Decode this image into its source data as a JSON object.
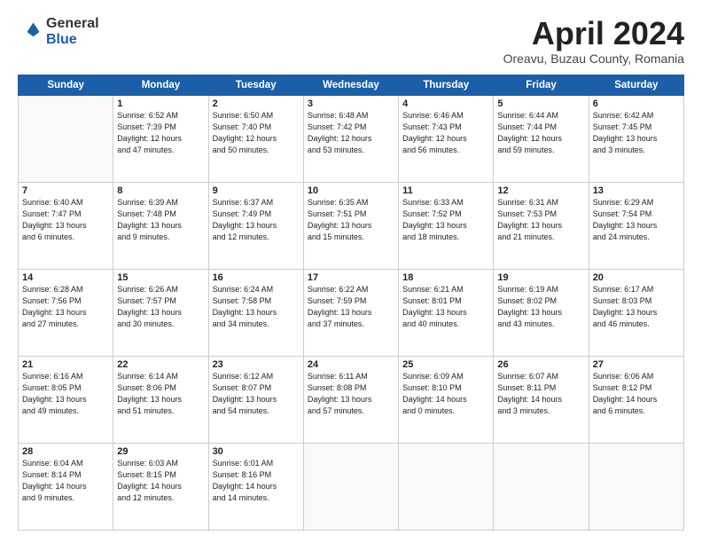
{
  "logo": {
    "general": "General",
    "blue": "Blue"
  },
  "title": "April 2024",
  "subtitle": "Oreavu, Buzau County, Romania",
  "days_header": [
    "Sunday",
    "Monday",
    "Tuesday",
    "Wednesday",
    "Thursday",
    "Friday",
    "Saturday"
  ],
  "weeks": [
    [
      {
        "day": "",
        "info": ""
      },
      {
        "day": "1",
        "info": "Sunrise: 6:52 AM\nSunset: 7:39 PM\nDaylight: 12 hours\nand 47 minutes."
      },
      {
        "day": "2",
        "info": "Sunrise: 6:50 AM\nSunset: 7:40 PM\nDaylight: 12 hours\nand 50 minutes."
      },
      {
        "day": "3",
        "info": "Sunrise: 6:48 AM\nSunset: 7:42 PM\nDaylight: 12 hours\nand 53 minutes."
      },
      {
        "day": "4",
        "info": "Sunrise: 6:46 AM\nSunset: 7:43 PM\nDaylight: 12 hours\nand 56 minutes."
      },
      {
        "day": "5",
        "info": "Sunrise: 6:44 AM\nSunset: 7:44 PM\nDaylight: 12 hours\nand 59 minutes."
      },
      {
        "day": "6",
        "info": "Sunrise: 6:42 AM\nSunset: 7:45 PM\nDaylight: 13 hours\nand 3 minutes."
      }
    ],
    [
      {
        "day": "7",
        "info": "Sunrise: 6:40 AM\nSunset: 7:47 PM\nDaylight: 13 hours\nand 6 minutes."
      },
      {
        "day": "8",
        "info": "Sunrise: 6:39 AM\nSunset: 7:48 PM\nDaylight: 13 hours\nand 9 minutes."
      },
      {
        "day": "9",
        "info": "Sunrise: 6:37 AM\nSunset: 7:49 PM\nDaylight: 13 hours\nand 12 minutes."
      },
      {
        "day": "10",
        "info": "Sunrise: 6:35 AM\nSunset: 7:51 PM\nDaylight: 13 hours\nand 15 minutes."
      },
      {
        "day": "11",
        "info": "Sunrise: 6:33 AM\nSunset: 7:52 PM\nDaylight: 13 hours\nand 18 minutes."
      },
      {
        "day": "12",
        "info": "Sunrise: 6:31 AM\nSunset: 7:53 PM\nDaylight: 13 hours\nand 21 minutes."
      },
      {
        "day": "13",
        "info": "Sunrise: 6:29 AM\nSunset: 7:54 PM\nDaylight: 13 hours\nand 24 minutes."
      }
    ],
    [
      {
        "day": "14",
        "info": "Sunrise: 6:28 AM\nSunset: 7:56 PM\nDaylight: 13 hours\nand 27 minutes."
      },
      {
        "day": "15",
        "info": "Sunrise: 6:26 AM\nSunset: 7:57 PM\nDaylight: 13 hours\nand 30 minutes."
      },
      {
        "day": "16",
        "info": "Sunrise: 6:24 AM\nSunset: 7:58 PM\nDaylight: 13 hours\nand 34 minutes."
      },
      {
        "day": "17",
        "info": "Sunrise: 6:22 AM\nSunset: 7:59 PM\nDaylight: 13 hours\nand 37 minutes."
      },
      {
        "day": "18",
        "info": "Sunrise: 6:21 AM\nSunset: 8:01 PM\nDaylight: 13 hours\nand 40 minutes."
      },
      {
        "day": "19",
        "info": "Sunrise: 6:19 AM\nSunset: 8:02 PM\nDaylight: 13 hours\nand 43 minutes."
      },
      {
        "day": "20",
        "info": "Sunrise: 6:17 AM\nSunset: 8:03 PM\nDaylight: 13 hours\nand 46 minutes."
      }
    ],
    [
      {
        "day": "21",
        "info": "Sunrise: 6:16 AM\nSunset: 8:05 PM\nDaylight: 13 hours\nand 49 minutes."
      },
      {
        "day": "22",
        "info": "Sunrise: 6:14 AM\nSunset: 8:06 PM\nDaylight: 13 hours\nand 51 minutes."
      },
      {
        "day": "23",
        "info": "Sunrise: 6:12 AM\nSunset: 8:07 PM\nDaylight: 13 hours\nand 54 minutes."
      },
      {
        "day": "24",
        "info": "Sunrise: 6:11 AM\nSunset: 8:08 PM\nDaylight: 13 hours\nand 57 minutes."
      },
      {
        "day": "25",
        "info": "Sunrise: 6:09 AM\nSunset: 8:10 PM\nDaylight: 14 hours\nand 0 minutes."
      },
      {
        "day": "26",
        "info": "Sunrise: 6:07 AM\nSunset: 8:11 PM\nDaylight: 14 hours\nand 3 minutes."
      },
      {
        "day": "27",
        "info": "Sunrise: 6:06 AM\nSunset: 8:12 PM\nDaylight: 14 hours\nand 6 minutes."
      }
    ],
    [
      {
        "day": "28",
        "info": "Sunrise: 6:04 AM\nSunset: 8:14 PM\nDaylight: 14 hours\nand 9 minutes."
      },
      {
        "day": "29",
        "info": "Sunrise: 6:03 AM\nSunset: 8:15 PM\nDaylight: 14 hours\nand 12 minutes."
      },
      {
        "day": "30",
        "info": "Sunrise: 6:01 AM\nSunset: 8:16 PM\nDaylight: 14 hours\nand 14 minutes."
      },
      {
        "day": "",
        "info": ""
      },
      {
        "day": "",
        "info": ""
      },
      {
        "day": "",
        "info": ""
      },
      {
        "day": "",
        "info": ""
      }
    ]
  ]
}
